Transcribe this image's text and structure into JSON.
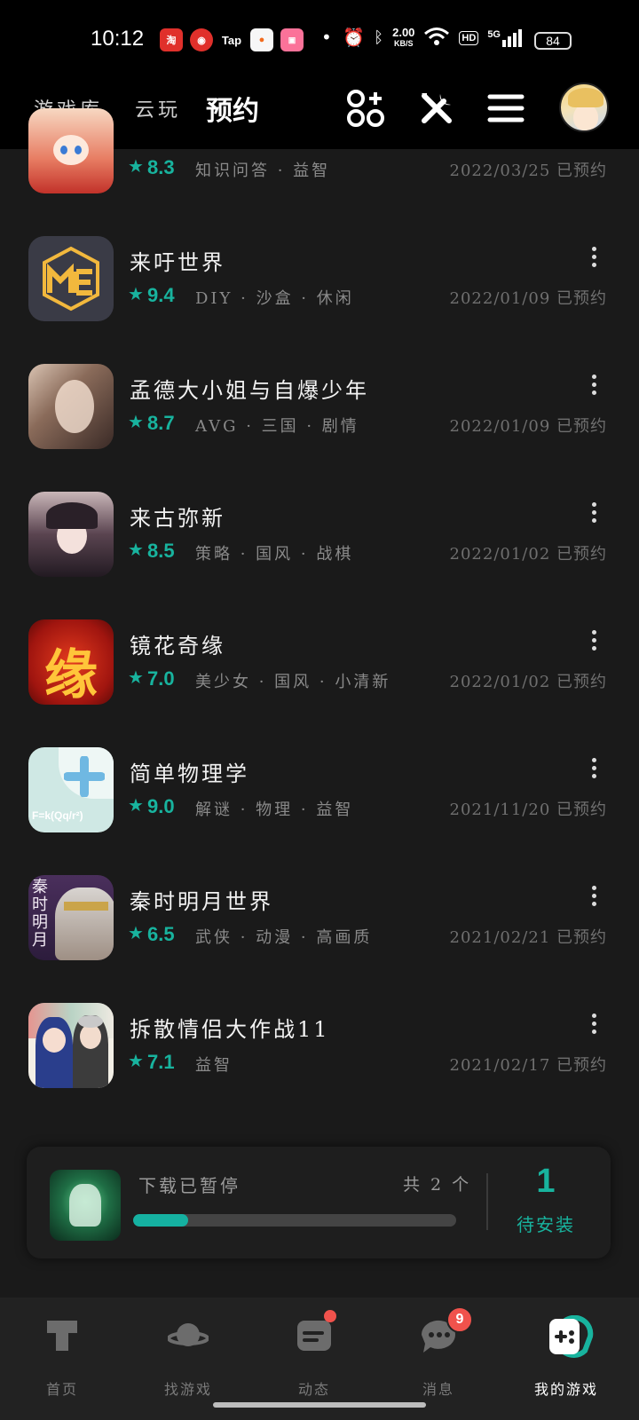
{
  "status_bar": {
    "time": "10:12",
    "apps": [
      "淘",
      "Tap"
    ],
    "dot": "•",
    "net_speed": "2.00",
    "net_unit": "KB/S",
    "hd": "HD",
    "signal": "5G",
    "battery": "84"
  },
  "header": {
    "tabs": [
      {
        "label": "游戏库",
        "active": false
      },
      {
        "label": "云玩",
        "active": false
      },
      {
        "label": "预约",
        "active": true
      }
    ],
    "icons": [
      "apps-grid-icon",
      "tools-icon",
      "menu-icon"
    ],
    "accent": "#14b5a3"
  },
  "games": [
    {
      "title": "",
      "rating": "8.3",
      "tags": "知识问答 · 益智",
      "date": "2022/03/25 已预约",
      "icon": "cartoon-girl-icon"
    },
    {
      "title": "来吁世界",
      "rating": "9.4",
      "tags": "DIY · 沙盒 · 休闲",
      "date": "2022/01/09 已预约",
      "icon": "me-cube-icon"
    },
    {
      "title": "孟德大小姐与自爆少年",
      "rating": "8.7",
      "tags": "AVG · 三国 · 剧情",
      "date": "2022/01/09 已预约",
      "icon": "anime-portrait-icon"
    },
    {
      "title": "来古弥新",
      "rating": "8.5",
      "tags": "策略 · 国风 · 战棋",
      "date": "2022/01/02 已预约",
      "icon": "gothic-girl-icon"
    },
    {
      "title": "镜花奇缘",
      "rating": "7.0",
      "tags": "美少女 · 国风 · 小清新",
      "date": "2022/01/02 已预约",
      "icon": "yuan-character-icon"
    },
    {
      "title": "简单物理学",
      "rating": "9.0",
      "tags": "解谜 · 物理 · 益智",
      "date": "2021/11/20 已预约",
      "icon": "physics-plus-icon",
      "icon_text": "F=k(Qq/r²)"
    },
    {
      "title": "秦时明月世界",
      "rating": "6.5",
      "tags": "武侠 · 动漫 · 高画质",
      "date": "2021/02/21 已预约",
      "icon": "qin-warrior-icon",
      "icon_text": "秦时明月"
    },
    {
      "title": "拆散情侣大作战11",
      "rating": "7.1",
      "tags": "益智",
      "date": "2021/02/17 已预约",
      "icon": "couple-icon"
    }
  ],
  "download": {
    "status": "下载已暂停",
    "count_text": "共 2 个",
    "progress": 0.17,
    "pending_count": "1",
    "pending_label": "待安装"
  },
  "bottom_nav": [
    {
      "label": "首页",
      "icon": "taptap-home-icon",
      "active": false
    },
    {
      "label": "找游戏",
      "icon": "planet-icon",
      "active": false
    },
    {
      "label": "动态",
      "icon": "feed-icon",
      "active": false,
      "badge": "dot"
    },
    {
      "label": "消息",
      "icon": "chat-icon",
      "active": false,
      "badge": "9"
    },
    {
      "label": "我的游戏",
      "icon": "gamepad-icon",
      "active": true
    }
  ],
  "colors": {
    "accent": "#18b39e",
    "badge": "#f0524c",
    "background": "#1a1a1a"
  }
}
